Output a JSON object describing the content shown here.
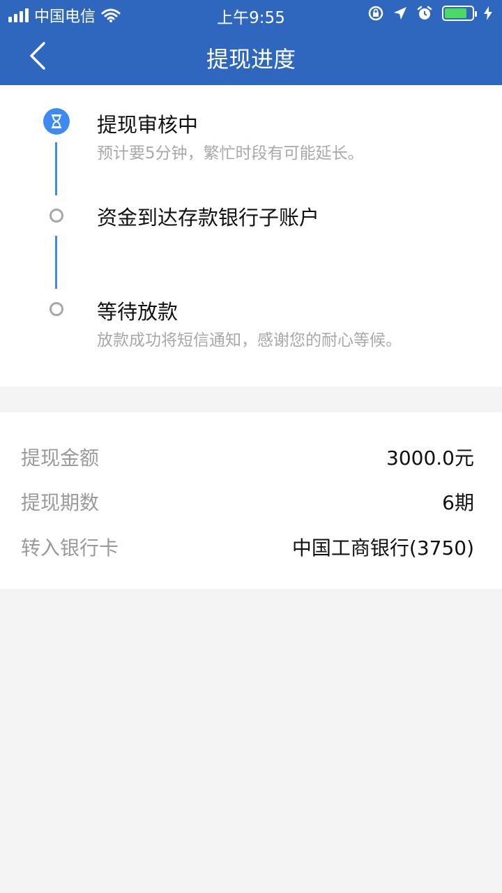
{
  "statusbar": {
    "carrier": "中国电信",
    "time": "上午9:55",
    "battery_level": 0.82,
    "battery_color": "#4cd964",
    "icons": [
      "signal-icon",
      "wifi-icon",
      "orientation-lock-icon",
      "location-icon",
      "alarm-icon",
      "battery-icon",
      "charging-icon"
    ]
  },
  "header": {
    "title": "提现进度",
    "back_icon": "chevron-left-icon",
    "bg_color": "#2e67bd"
  },
  "steps": [
    {
      "title": "提现审核中",
      "desc": "预计要5分钟，繁忙时段有可能延长。",
      "state": "active",
      "icon": "hourglass-icon"
    },
    {
      "title": "资金到达存款银行子账户",
      "desc": "",
      "state": "pending"
    },
    {
      "title": "等待放款",
      "desc": "放款成功将短信通知，感谢您的耐心等候。",
      "state": "pending"
    }
  ],
  "accent_color": "#3d8bf1",
  "details": [
    {
      "label": "提现金额",
      "value": "3000.0元"
    },
    {
      "label": "提现期数",
      "value": "6期"
    },
    {
      "label": "转入银行卡",
      "value": "中国工商银行(3750)"
    }
  ]
}
